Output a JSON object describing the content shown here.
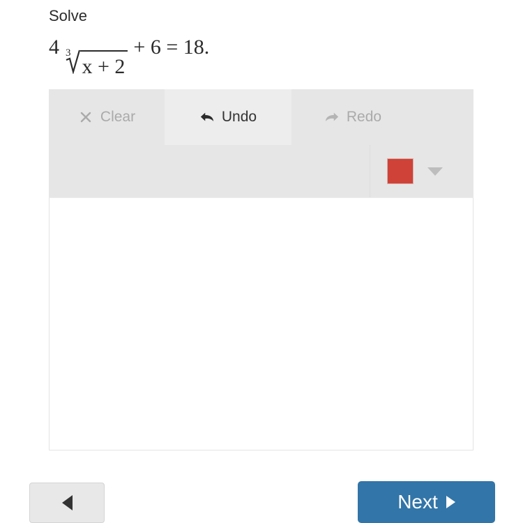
{
  "prompt": {
    "title": "Solve",
    "equation_plain": "4 cube-root(x + 2) + 6 = 18.",
    "coefficient": "4",
    "radical_index": "3",
    "radicand": "x + 2",
    "rest": "+ 6 = 18",
    "period": "."
  },
  "toolbar": {
    "clear": {
      "label": "Clear",
      "icon": "close-x-icon",
      "enabled": false
    },
    "undo": {
      "label": "Undo",
      "icon": "undo-arrow-icon",
      "enabled": true
    },
    "redo": {
      "label": "Redo",
      "icon": "redo-arrow-icon",
      "enabled": false
    },
    "color_picker": {
      "selected_color": "#cf4238",
      "caret_icon": "chevron-down-icon"
    }
  },
  "canvas": {
    "content": ""
  },
  "footer": {
    "back": {
      "label": "",
      "icon": "triangle-left-icon"
    },
    "next": {
      "label": "Next",
      "icon": "triangle-right-icon"
    }
  },
  "colors": {
    "toolbar_bg": "#e6e6e6",
    "toolbar_active_bg": "#ededed",
    "disabled_text": "#aaaaaa",
    "enabled_text": "#333333",
    "swatch_red": "#cf4238",
    "next_blue": "#3275a8",
    "back_gray": "#e8e8e8"
  }
}
